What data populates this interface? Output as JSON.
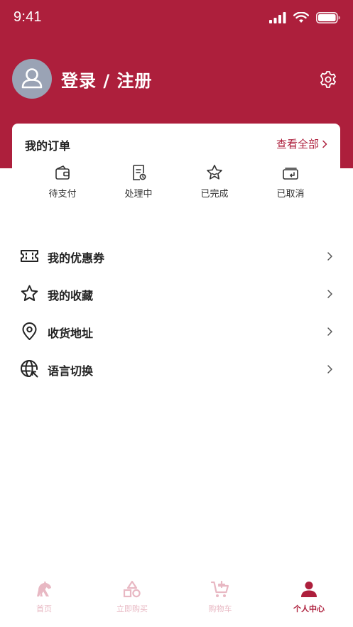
{
  "status_bar": {
    "time": "9:41"
  },
  "profile": {
    "login_label": "登录 / 注册"
  },
  "orders": {
    "title": "我的订单",
    "view_all": "查看全部",
    "items": [
      {
        "label": "待支付",
        "icon": "wallet-icon"
      },
      {
        "label": "处理中",
        "icon": "document-processing-icon"
      },
      {
        "label": "已完成",
        "icon": "star-completed-icon"
      },
      {
        "label": "已取消",
        "icon": "wallet-cancel-icon"
      }
    ]
  },
  "menu": [
    {
      "label": "我的优惠券",
      "icon": "coupon-icon"
    },
    {
      "label": "我的收藏",
      "icon": "star-icon"
    },
    {
      "label": "收货地址",
      "icon": "location-pin-icon"
    },
    {
      "label": "语言切换",
      "icon": "globe-icon"
    }
  ],
  "tab_bar": [
    {
      "label": "首页",
      "icon": "horse-icon",
      "active": false
    },
    {
      "label": "立即购买",
      "icon": "shapes-icon",
      "active": false
    },
    {
      "label": "购物车",
      "icon": "cart-icon",
      "active": false
    },
    {
      "label": "个人中心",
      "icon": "person-icon",
      "active": true
    }
  ],
  "colors": {
    "brand": "#ad1f3c",
    "tab_inactive": "#e8b8c3",
    "avatar_bg": "#9aa3b5"
  }
}
